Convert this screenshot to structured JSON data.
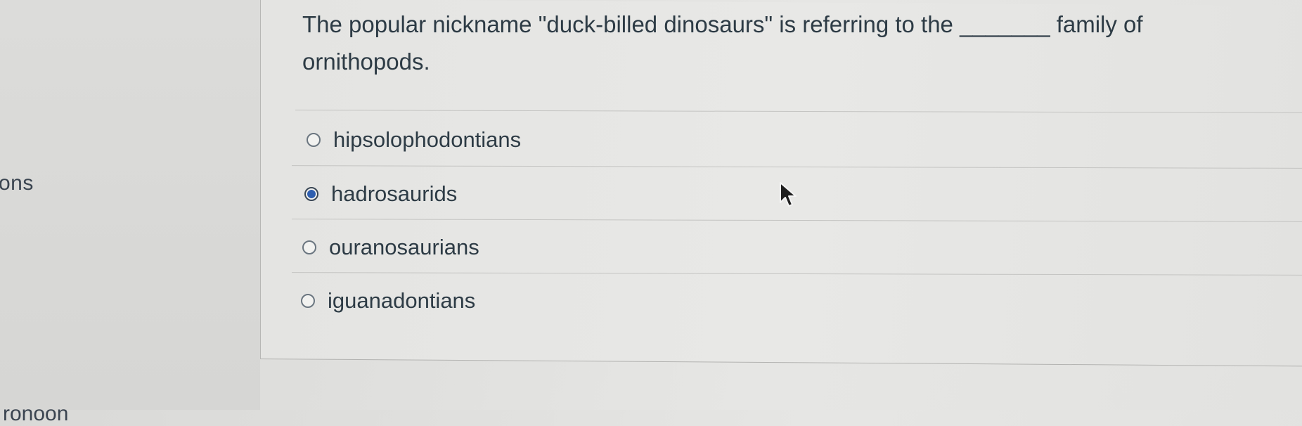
{
  "sidebar": {
    "partial_text": "ons",
    "bottom_partial_text": "ronoon"
  },
  "question": {
    "text": "The popular nickname \"duck-billed dinosaurs\" is referring to the _______ family of ornithopods."
  },
  "answers": [
    {
      "label": "hipsolophodontians",
      "selected": false
    },
    {
      "label": "hadrosaurids",
      "selected": true
    },
    {
      "label": "ouranosaurians",
      "selected": false
    },
    {
      "label": "iguanadontians",
      "selected": false
    }
  ]
}
